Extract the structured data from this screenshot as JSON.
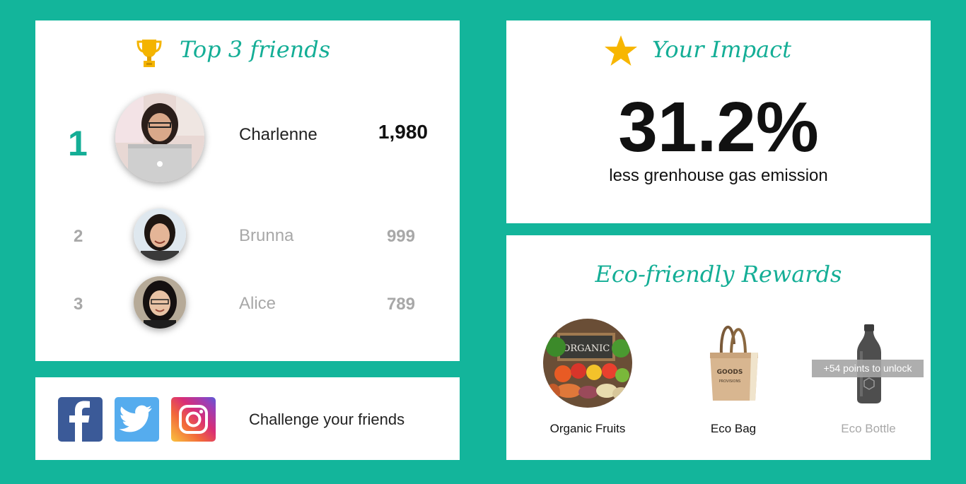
{
  "colors": {
    "background": "#13b59b",
    "accent": "#14ae96",
    "star": "#f7b600"
  },
  "friends_card": {
    "title": "Top 3 friends",
    "icon": "trophy-icon",
    "friends": [
      {
        "rank": "1",
        "name": "Charlenne",
        "score": "1,980"
      },
      {
        "rank": "2",
        "name": "Brunna",
        "score": "999"
      },
      {
        "rank": "3",
        "name": "Alice",
        "score": "789"
      }
    ]
  },
  "impact_card": {
    "title": "Your Impact",
    "icon": "star-icon",
    "value": "31.2%",
    "caption": "less grenhouse gas emission"
  },
  "rewards_card": {
    "title": "Eco-friendly Rewards",
    "items": [
      {
        "label": "Organic Fruits",
        "image": "organic-fruits-image",
        "locked": false
      },
      {
        "label": "Eco Bag",
        "image": "eco-bag-image",
        "locked": false
      },
      {
        "label": "Eco Bottle",
        "image": "eco-bottle-image",
        "locked": true,
        "lock_text": "+54 points to unlock"
      }
    ]
  },
  "share_card": {
    "icons": [
      "facebook-icon",
      "twitter-icon",
      "instagram-icon"
    ],
    "label": "Challenge your friends"
  }
}
